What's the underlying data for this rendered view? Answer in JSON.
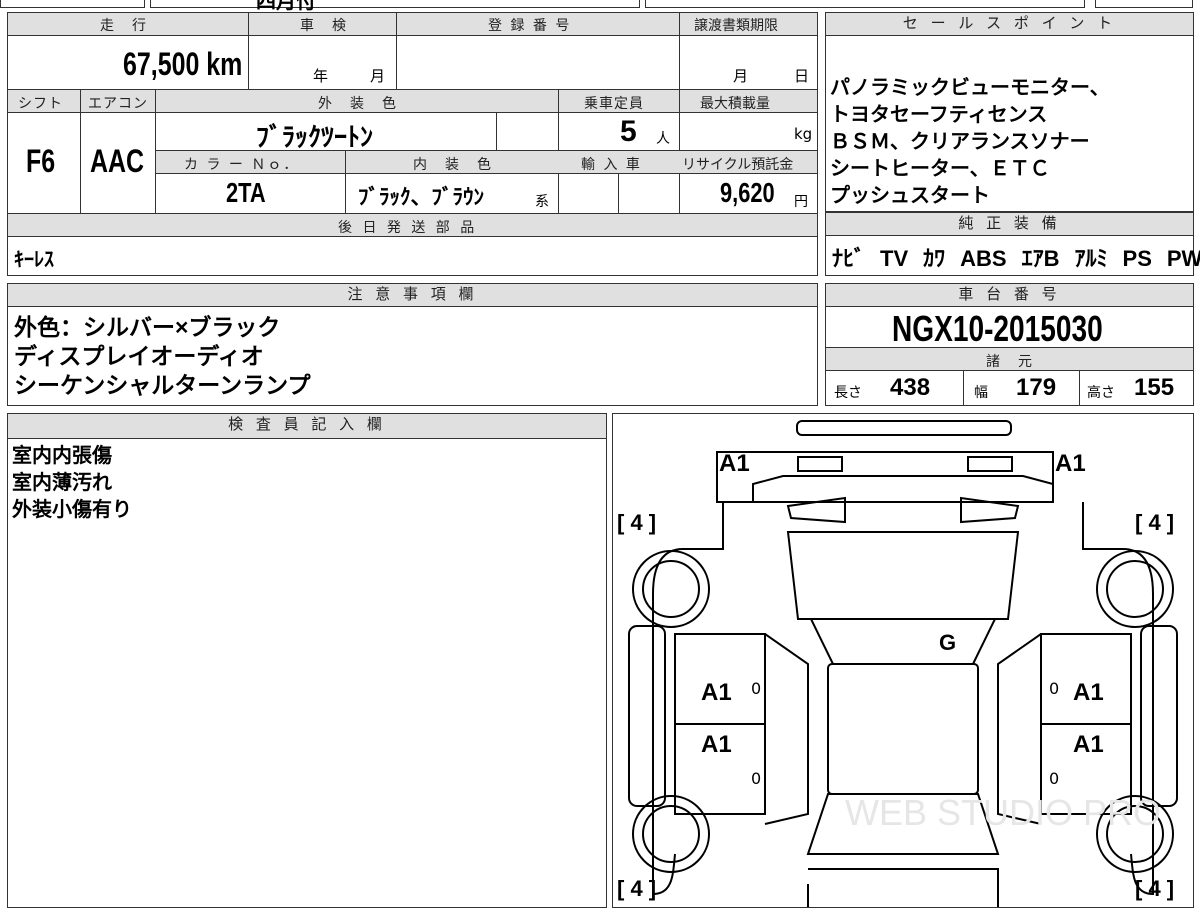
{
  "top_strip": {
    "partial_text": "四月付"
  },
  "spec": {
    "mileage_label": "走　行",
    "mileage_value": "67,500 km",
    "inspection_label": "車　検",
    "inspection_year_unit": "年",
    "inspection_month_unit": "月",
    "registration_label": "登 録 番 号",
    "registration_value": "",
    "transfer_deadline_label": "譲渡書類期限",
    "transfer_month_unit": "月",
    "transfer_day_unit": "日",
    "shift_label": "シフト",
    "shift_value": "F6",
    "ac_label": "エアコン",
    "ac_value": "AAC",
    "exterior_color_label": "外　装　色",
    "exterior_color_value": "ﾌﾞﾗｯｸﾂｰﾄﾝ",
    "capacity_label": "乗車定員",
    "capacity_value": "5",
    "capacity_unit": "人",
    "max_load_label": "最大積載量",
    "max_load_unit": "kg",
    "color_no_label": "カ ラ ー Ｎｏ．",
    "color_no_value": "2TA",
    "interior_color_label": "内　装　色",
    "interior_color_value": "ﾌﾞﾗｯｸ、ﾌﾞﾗｳﾝ",
    "interior_color_suffix": "系",
    "import_label": "輸 入 車",
    "recycle_label": "リサイクル預託金",
    "recycle_value": "9,620",
    "recycle_unit": "円",
    "later_parts_label": "後 日 発 送 部 品",
    "later_parts_value": "ｷｰﾚｽ"
  },
  "sales_points": {
    "label": "セ ー ル ス ポ イ ン ト",
    "lines": [
      "パノラミックビューモニター、",
      "トヨタセーフティセンス",
      "ＢＳＭ、クリアランスソナー",
      "シートヒーター、ＥＴＣ",
      "プッシュスタート"
    ]
  },
  "equipment": {
    "label": "純 正 装 備",
    "items": [
      "ﾅﾋﾞ",
      "TV",
      "ｶﾜ",
      "ABS",
      "ｴｱB",
      "ｱﾙﾐ",
      "PS",
      "PW"
    ]
  },
  "notes": {
    "label": "注 意 事 項 欄",
    "lines": [
      "外色：シルバー×ブラック",
      "ディスプレイオーディオ",
      "シーケンシャルターンランプ"
    ]
  },
  "chassis": {
    "label": "車 台 番 号",
    "value": "NGX10-2015030",
    "specs_label": "諸　元",
    "length_label": "長さ",
    "length_value": "438",
    "width_label": "幅",
    "width_value": "179",
    "height_label": "高さ",
    "height_value": "155"
  },
  "inspector": {
    "label": "検 査 員 記 入 欄",
    "lines": [
      "室内内張傷",
      "室内薄汚れ",
      "外装小傷有り"
    ]
  },
  "diagram": {
    "marks": {
      "front_left": "A1",
      "front_right": "A1",
      "tire_fl": "[ 4 ]",
      "tire_fr": "[ 4 ]",
      "tire_rl": "[ 4 ]",
      "tire_rr": "[ 4 ]",
      "glass": "G",
      "door_fl": "A1",
      "door_fr": "A1",
      "door_rl": "A1",
      "door_rr": "A1",
      "zero": "0"
    },
    "watermark": "WEB STUDIO PRO"
  }
}
